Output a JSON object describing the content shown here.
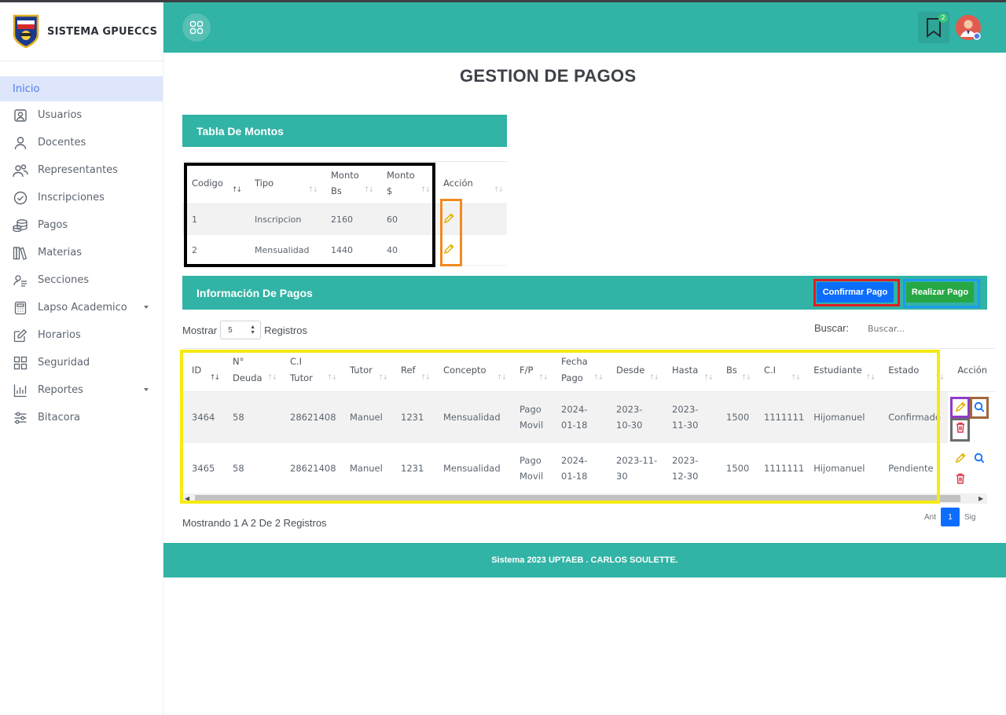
{
  "app": {
    "brand_name": "SISTEMA GPUECCS"
  },
  "sidebar": {
    "items": [
      {
        "label": "Inicio",
        "icon": "none",
        "active": true
      },
      {
        "label": "Usuarios",
        "icon": "user-badge-icon"
      },
      {
        "label": "Docentes",
        "icon": "person-icon"
      },
      {
        "label": "Representantes",
        "icon": "people-icon"
      },
      {
        "label": "Inscripciones",
        "icon": "check-circle-icon"
      },
      {
        "label": "Pagos",
        "icon": "coins-icon"
      },
      {
        "label": "Materias",
        "icon": "books-icon"
      },
      {
        "label": "Secciones",
        "icon": "section-icon"
      },
      {
        "label": "Lapso Academico",
        "icon": "calculator-icon",
        "has_submenu": true
      },
      {
        "label": "Horarios",
        "icon": "edit-note-icon"
      },
      {
        "label": "Seguridad",
        "icon": "grid-icon"
      },
      {
        "label": "Reportes",
        "icon": "bar-chart-icon",
        "has_submenu": true
      },
      {
        "label": "Bitacora",
        "icon": "sliders-icon"
      }
    ]
  },
  "header": {
    "notification_count": "2"
  },
  "page": {
    "title": "GESTION DE PAGOS"
  },
  "montos": {
    "title": "Tabla De Montos",
    "columns": [
      "Codigo",
      "Tipo",
      "Monto\nBs",
      "Monto\n$",
      "Acción"
    ],
    "rows": [
      {
        "codigo": "1",
        "tipo": "Inscripcion",
        "bs": "2160",
        "usd": "60"
      },
      {
        "codigo": "2",
        "tipo": "Mensualidad",
        "bs": "1440",
        "usd": "40"
      }
    ]
  },
  "pagos": {
    "title": "Información De Pagos",
    "confirm_label": "Confirmar Pago",
    "realizar_label": "Realizar Pago",
    "show_label": "Mostrar",
    "page_size": "5",
    "records_label": "Registros",
    "search_label": "Buscar:",
    "search_placeholder": "Buscar...",
    "columns": [
      "ID",
      "N°\nDeuda",
      "C.I\nTutor",
      "Tutor",
      "Ref",
      "Concepto",
      "F/P",
      "Fecha\nPago",
      "Desde",
      "Hasta",
      "Bs",
      "C.I",
      "Estudiante",
      "Estado",
      "Acción"
    ],
    "rows": [
      {
        "id": "3464",
        "deuda": "58",
        "ci_tutor": "28621408",
        "tutor": "Manuel",
        "ref": "1231",
        "concepto": "Mensualidad",
        "fp": "Pago\nMovil",
        "fecha": "2024-\n01-18",
        "desde": "2023-\n10-30",
        "hasta": "2023-\n11-30",
        "bs": "1500",
        "ci": "1111111",
        "estudiante": "Hijomanuel",
        "estado": "Confirmado"
      },
      {
        "id": "3465",
        "deuda": "58",
        "ci_tutor": "28621408",
        "tutor": "Manuel",
        "ref": "1231",
        "concepto": "Mensualidad",
        "fp": "Pago\nMovil",
        "fecha": "2024-\n01-18",
        "desde": "2023-11-\n30",
        "hasta": "2023-\n12-30",
        "bs": "1500",
        "ci": "1111111",
        "estudiante": "Hijomanuel",
        "estado": "Pendiente"
      }
    ],
    "info_text": "Mostrando 1 A 2 De 2 Registros",
    "pager": {
      "prev": "Ant",
      "current": "1",
      "next": "Sig"
    }
  },
  "footer": {
    "text": "Sistema 2023 UPTAEB . CARLOS SOULETTE."
  },
  "colors": {
    "teal": "#31b3a5",
    "primary": "#0d6efd",
    "success": "#28a745",
    "edit": "#e0b400",
    "search": "#0d6efd",
    "delete": "#dc3545"
  }
}
